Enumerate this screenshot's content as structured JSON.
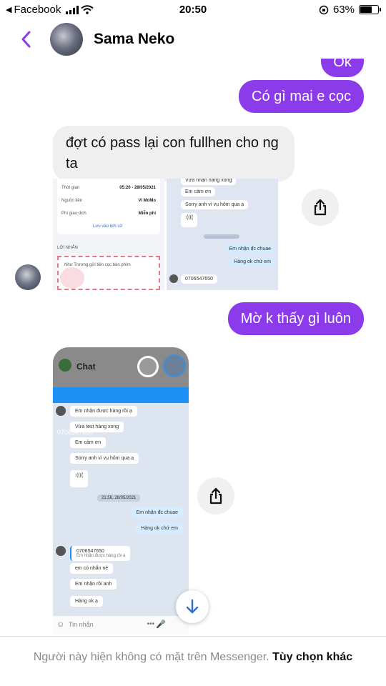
{
  "status_bar": {
    "back_app": "Facebook",
    "time": "20:50",
    "battery": "63%",
    "battery_level": 0.63
  },
  "header": {
    "contact_name": "Sama Neko"
  },
  "messages": {
    "out_ok": "Ok",
    "out_1": "Có gì mai e cọc",
    "in_1": "đợt có pass lại con fullhen cho ng ta",
    "out_2": "Mờ k thấy gì luôn"
  },
  "screenshot_1": {
    "rows": [
      {
        "label": "Thời gian",
        "value": "05:20 - 28/05/2021"
      },
      {
        "label": "Nguồn tiền",
        "value": "Ví MoMo"
      },
      {
        "label": "Phí giao dịch",
        "value": "Miễn phí"
      }
    ],
    "save_link": "Lưu vào lịch sử",
    "section": "LỜI NHẮN",
    "note": "Như Trương gửi tiền cọc bàn phím",
    "chat": [
      "Vừa nhận hàng xong",
      "Em cảm ơn",
      "Sorry anh vì vụ hôm qua ạ",
      "Em nhận đc chuae",
      "Hàng ok chứ em",
      "0706547650"
    ]
  },
  "screenshot_2": {
    "title": "Chat",
    "phone": "0706547650",
    "date_sep": "21:56, 28/05/2021",
    "messages_in": [
      "Em nhận được hàng rồi ạ",
      "Vừa test hàng xong",
      "Em cảm ơn",
      "Sorry anh vì vụ hôm qua ạ"
    ],
    "messages_out": [
      "Em nhận đc chuae",
      "Hàng ok chứ em"
    ],
    "reply_quote": "0706547650",
    "reply_sub": "Em nhận được hàng rồi ạ",
    "messages_in_2": [
      "em có nhắn nè",
      "Em nhận rồi anh",
      "Hàng ok ạ"
    ],
    "input_placeholder": "Tin nhắn"
  },
  "footer": {
    "message": "Người này hiện không có mặt trên Messenger.",
    "option": "Tùy chọn khác"
  },
  "colors": {
    "accent": "#8b3bea",
    "incoming_bubble": "#efefef"
  }
}
